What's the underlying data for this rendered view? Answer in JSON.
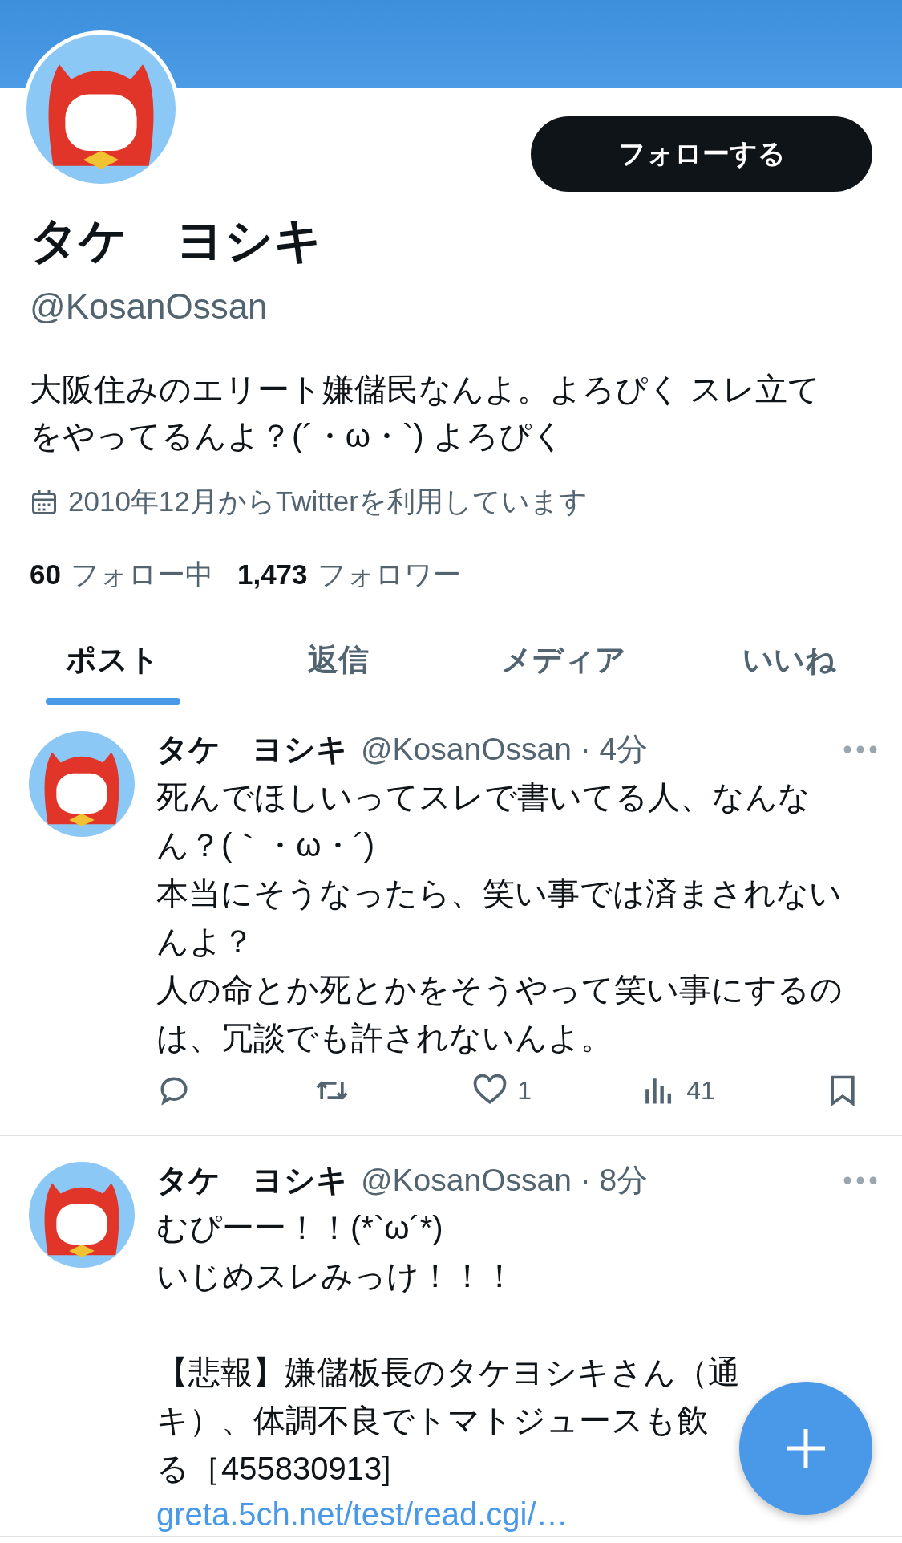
{
  "profile": {
    "name": "タケ　ヨシキ",
    "handle": "@KosanOssan",
    "bio": [
      "大阪住みのエリート嫌儲民なんよ。よろぴく スレ立て",
      "をやってるんよ？(´・ω・`) よろぴく"
    ],
    "joined": "2010年12月からTwitterを利用しています",
    "stats": [
      {
        "count": "60",
        "label": "フォロー中"
      },
      {
        "count": "1,473",
        "label": "フォロワー"
      }
    ]
  },
  "follow_button": "フォローする",
  "tabs": [
    {
      "label": "ポスト",
      "selected": true
    },
    {
      "label": "返信",
      "selected": false
    },
    {
      "label": "メディア",
      "selected": false
    },
    {
      "label": "いいね",
      "selected": false
    }
  ],
  "posts": [
    {
      "name": "タケ　ヨシキ",
      "meta": "@KosanOssan · 4分",
      "paragraphs": [
        [
          "死んでほしいってスレで書いてる人、なんな",
          "ん？(｀・ω・´)",
          "本当にそうなったら、笑い事では済まされない",
          "んよ？",
          "人の命とか死とかをそうやって笑い事にするの",
          "は、冗談でも許されないんよ。"
        ]
      ],
      "actions": [
        {
          "kind": "reply"
        },
        {
          "kind": "repost"
        },
        {
          "kind": "like",
          "count": "1"
        },
        {
          "kind": "views",
          "count": "41"
        },
        {
          "kind": "bookmark"
        }
      ]
    },
    {
      "name": "タケ　ヨシキ",
      "meta": "@KosanOssan · 8分",
      "paragraphs": [
        [
          "むぴーー！！(*`ω´*)",
          "いじめスレみっけ！！！"
        ],
        [
          "【悲報】嫌儲板長のタケヨシキさん（通",
          "キ）、体調不良でトマトジュースも飲",
          "る［455830913]"
        ]
      ],
      "link": "greta.5ch.net/test/read.cgi/…"
    }
  ]
}
